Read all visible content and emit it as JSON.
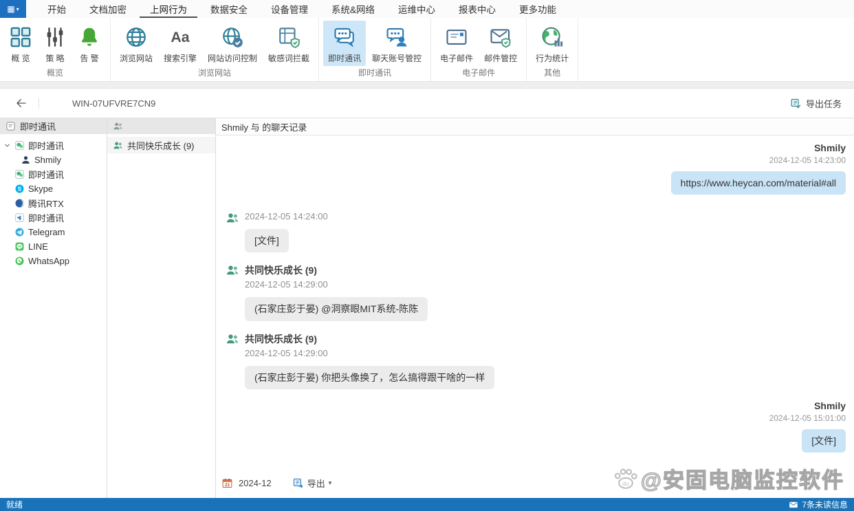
{
  "app": {
    "menu_glyph": "▦"
  },
  "tabs": [
    {
      "name": "home",
      "label": "开始",
      "active": false
    },
    {
      "name": "doc-encryption",
      "label": "文档加密",
      "active": false
    },
    {
      "name": "internet-behavior",
      "label": "上网行为",
      "active": true
    },
    {
      "name": "data-security",
      "label": "数据安全",
      "active": false
    },
    {
      "name": "device-management",
      "label": "设备管理",
      "active": false
    },
    {
      "name": "system-network",
      "label": "系统&网络",
      "active": false
    },
    {
      "name": "ops-center",
      "label": "运维中心",
      "active": false
    },
    {
      "name": "report-center",
      "label": "报表中心",
      "active": false
    },
    {
      "name": "more-features",
      "label": "更多功能",
      "active": false
    }
  ],
  "ribbon": {
    "groups": [
      {
        "label": "概览",
        "buttons": [
          {
            "name": "overview",
            "label": "概 览",
            "icon": "overview-grid-icon",
            "selected": false
          },
          {
            "name": "policy",
            "label": "策 略",
            "icon": "policy-sliders-icon",
            "selected": false
          },
          {
            "name": "alert",
            "label": "告 警",
            "icon": "alert-bell-icon",
            "selected": false
          }
        ]
      },
      {
        "label": "浏览网站",
        "buttons": [
          {
            "name": "browse-website",
            "label": "浏览网站",
            "icon": "browse-globe-icon",
            "selected": false
          },
          {
            "name": "search-engine",
            "label": "搜索引擎",
            "icon": "search-engine-icon",
            "selected": false
          },
          {
            "name": "site-access-control",
            "label": "网站访问控制",
            "icon": "site-access-icon",
            "selected": false
          },
          {
            "name": "sensitive-word-block",
            "label": "敏感词拦截",
            "icon": "sensitive-words-icon",
            "selected": false
          }
        ]
      },
      {
        "label": "即时通讯",
        "buttons": [
          {
            "name": "instant-messaging",
            "label": "即时通讯",
            "icon": "im-chat-icon",
            "selected": true
          },
          {
            "name": "chat-account-control",
            "label": "聊天账号管控",
            "icon": "chat-account-icon",
            "selected": false
          }
        ]
      },
      {
        "label": "电子邮件",
        "buttons": [
          {
            "name": "email",
            "label": "电子邮件",
            "icon": "email-icon",
            "selected": false
          },
          {
            "name": "email-control",
            "label": "邮件管控",
            "icon": "email-control-icon",
            "selected": false
          }
        ]
      },
      {
        "label": "其他",
        "buttons": [
          {
            "name": "behavior-statistics",
            "label": "行为统计",
            "icon": "behavior-stats-icon",
            "selected": false
          }
        ]
      }
    ]
  },
  "toolbar": {
    "device_name": "WIN-07UFVRE7CN9",
    "export_task_label": "导出任务"
  },
  "sidebar": {
    "header": {
      "label": "即时通讯",
      "icon": "im-app-icon"
    },
    "items": [
      {
        "name": "wechat-1",
        "label": "即时通讯",
        "icon": "wechat-icon",
        "caret": true,
        "indent": 0,
        "tint": ""
      },
      {
        "name": "wechat-1-shmily",
        "label": "Shmily",
        "icon": "person-icon",
        "caret": false,
        "indent": 1,
        "tint": "navy"
      },
      {
        "name": "wechat-2",
        "label": "即时通讯",
        "icon": "wechat-icon",
        "caret": false,
        "indent": 0,
        "tint": ""
      },
      {
        "name": "skype",
        "label": "Skype",
        "icon": "skype-icon",
        "caret": false,
        "indent": 0,
        "tint": ""
      },
      {
        "name": "tencent-rtx",
        "label": "腾讯RTX",
        "icon": "rtx-icon",
        "caret": false,
        "indent": 0,
        "tint": ""
      },
      {
        "name": "dingtalk",
        "label": "即时通讯",
        "icon": "dingtalk-icon",
        "caret": false,
        "indent": 0,
        "tint": ""
      },
      {
        "name": "telegram",
        "label": "Telegram",
        "icon": "telegram-icon",
        "caret": false,
        "indent": 0,
        "tint": ""
      },
      {
        "name": "line",
        "label": "LINE",
        "icon": "line-icon",
        "caret": false,
        "indent": 0,
        "tint": ""
      },
      {
        "name": "whatsapp",
        "label": "WhatsApp",
        "icon": "whatsapp-icon",
        "caret": false,
        "indent": 0,
        "tint": ""
      }
    ]
  },
  "contacts": {
    "header_icon": "group-icon",
    "items": [
      {
        "name": "group-happy-growth",
        "label": "共同快乐成长 (9)",
        "icon": "group-icon"
      }
    ]
  },
  "chat": {
    "title": "Shmily 与  的聊天记录",
    "messages": [
      {
        "side": "right",
        "sender": "Shmily",
        "time": "2024-12-05 14:23:00",
        "text": "https://www.heycan.com/material#all",
        "bubble": "blue"
      },
      {
        "side": "left",
        "sender": "",
        "time": "2024-12-05 14:24:00",
        "text": "[文件]",
        "bubble": "grey"
      },
      {
        "side": "left",
        "sender": "共同快乐成长 (9)",
        "time": "2024-12-05 14:29:00",
        "text": "(石家庄彭于晏) @洞察眼MIT系统-陈陈",
        "bubble": "grey"
      },
      {
        "side": "left",
        "sender": "共同快乐成长 (9)",
        "time": "2024-12-05 14:29:00",
        "text": "(石家庄彭于晏) 你把头像换了，怎么搞得跟干啥的一样",
        "bubble": "grey"
      },
      {
        "side": "right",
        "sender": "Shmily",
        "time": "2024-12-05 15:01:00",
        "text": "[文件]",
        "bubble": "blue"
      }
    ],
    "footer": {
      "date": "2024-12",
      "export_label": "导出",
      "caret": "▾"
    }
  },
  "watermark": {
    "text": "@安固电脑监控软件"
  },
  "statusbar": {
    "left": "就绪",
    "right": "7条未读信息"
  },
  "colors": {
    "accent_blue": "#1a73b8",
    "ribbon_selected": "#cde7f8",
    "bubble_blue": "#c9e4f6",
    "bubble_grey": "#ececec",
    "avatar_green": "#43987f",
    "bell_green": "#45a735"
  }
}
